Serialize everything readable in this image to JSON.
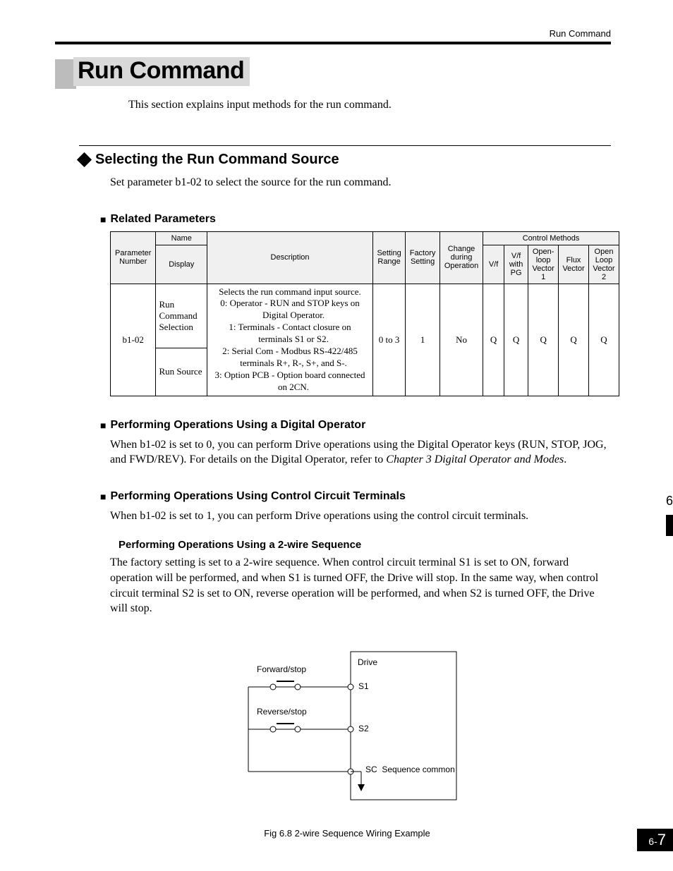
{
  "running_head": "Run Command",
  "main_title": "Run Command",
  "intro": "This section explains input methods for the run command.",
  "section": {
    "title": "Selecting the Run Command Source",
    "body": "Set parameter b1-02 to select the source for the run command."
  },
  "related": {
    "heading": "Related Parameters",
    "table": {
      "headers": {
        "param": "Parameter Number",
        "name": "Name",
        "display": "Display",
        "description": "Description",
        "range": "Setting Range",
        "factory": "Factory Setting",
        "change": "Change during Operation",
        "control": "Control Methods",
        "vf": "V/f",
        "vfpg": "V/f with PG",
        "olv": "Open-loop Vector 1",
        "flux": "Flux Vector",
        "olv2": "Open Loop Vector 2"
      },
      "row": {
        "param": "b1-02",
        "name": "Run Command Selection",
        "display": "Run Source",
        "desc_l1": "Selects the run command input source.",
        "desc_l2": "0: Operator - RUN and STOP keys on",
        "desc_l2b": "Digital Operator.",
        "desc_l3": "1: Terminals - Contact closure on",
        "desc_l3b": "terminals S1 or S2.",
        "desc_l4": "2: Serial Com - Modbus RS-422/485",
        "desc_l4b": "terminals R+, R-, S+, and S-.",
        "desc_l5": "3: Option PCB - Option board connected",
        "desc_l5b": "on 2CN.",
        "range": "0 to 3",
        "factory": "1",
        "change": "No",
        "vf": "Q",
        "vfpg": "Q",
        "olv": "Q",
        "flux": "Q",
        "olv2": "Q"
      }
    }
  },
  "digital_op": {
    "heading": "Performing Operations Using a Digital Operator",
    "body_a": "When b1-02 is set to 0, you can perform Drive operations using the Digital Operator keys (RUN, STOP, JOG, and FWD/REV). For details on the Digital Operator, refer to ",
    "body_ref": "Chapter 3   Digital Operator and Modes",
    "body_b": "."
  },
  "terminals": {
    "heading": "Performing Operations Using Control Circuit Terminals",
    "body": "When b1-02 is set to 1, you can perform Drive operations using the control circuit terminals."
  },
  "twowire": {
    "heading": "Performing Operations Using a 2-wire Sequence",
    "body": "The factory setting is set to a 2-wire sequence. When control circuit terminal S1 is set to ON, forward operation will be performed, and when S1 is turned OFF, the Drive will stop. In the same way, when control circuit terminal S2 is set to ON, reverse operation will be performed, and when S2 is turned OFF, the Drive will stop."
  },
  "figure": {
    "fwd": "Forward/stop",
    "rev": "Reverse/stop",
    "drive": "Drive",
    "s1": "S1",
    "s2": "S2",
    "sc": "SC",
    "seq": "Sequence common",
    "caption": "Fig 6.8  2-wire Sequence Wiring Example"
  },
  "page": {
    "section": "6",
    "pnum_prefix": "6-",
    "pnum": "7"
  }
}
